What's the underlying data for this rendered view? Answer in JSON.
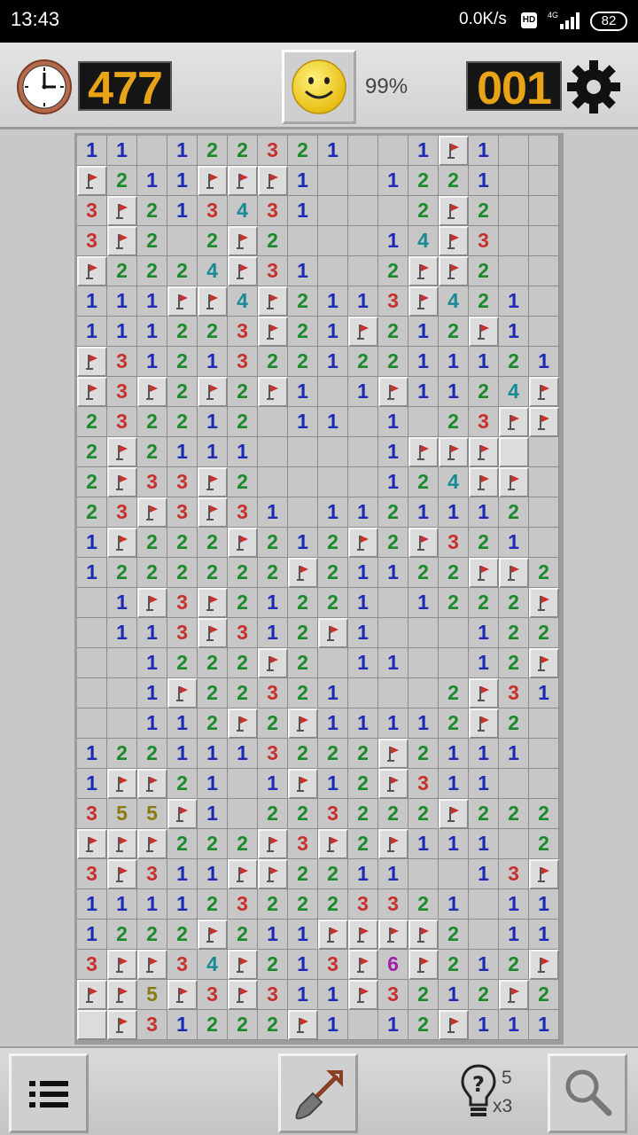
{
  "status_bar": {
    "time": "13:43",
    "network_speed": "0.0K/s",
    "hd_badge": "HD",
    "network_type": "4G",
    "battery": "82"
  },
  "header": {
    "timer": "477",
    "progress": "99%",
    "mines_left": "001",
    "face": "smiley-face-icon"
  },
  "board": {
    "columns": 16,
    "rows": [
      "11 122321  1F1  ",
      "F211FFF1  1221  ",
      "3F213431   2F2  ",
      "3F2 2F2   14F3  ",
      "F2224F31  2FF2  ",
      "111FF4F2113F421 ",
      "111223F21F212F1 ",
      "F312132212211121",
      "F3F2F2F1 1F1124F",
      "232212 11 1 23FFF",
      "2F2111    1FFF# ",
      "2F33F2    124FF",
      "23F3F31 1121112 2",
      "1F222F212F2F321 ",
      "1222222F21122FF21",
      " 1F3F21221 1222F",
      " 113F312F1   122",
      "  1222F2 11  12F1",
      "  1F22321   2F31",
      "  112F2F11112F2 ",
      "1221113222F2111 ",
      "1FF21 1F12F311  ",
      "355F1 223222F222",
      "FFF222F3F2F111 2FF",
      "3F311FF2211  13F",
      "1111232223321 11",
      "1222F211FFFF2 11",
      "3FF34F213F6F212F",
      "FF5F3F311F3212F2",
      "#F31222F1 12F1111"
    ]
  },
  "bottom_bar": {
    "hint_count": "5",
    "hint_multiplier": "x3"
  },
  "colors": {
    "n1": "#1c2ab4",
    "n2": "#1a8a2a",
    "n3": "#c8302c",
    "n4": "#178a96",
    "n5": "#8a7a10",
    "n6": "#a020a8",
    "lcd_text": "#e8a316",
    "flag": "#c8302c"
  }
}
